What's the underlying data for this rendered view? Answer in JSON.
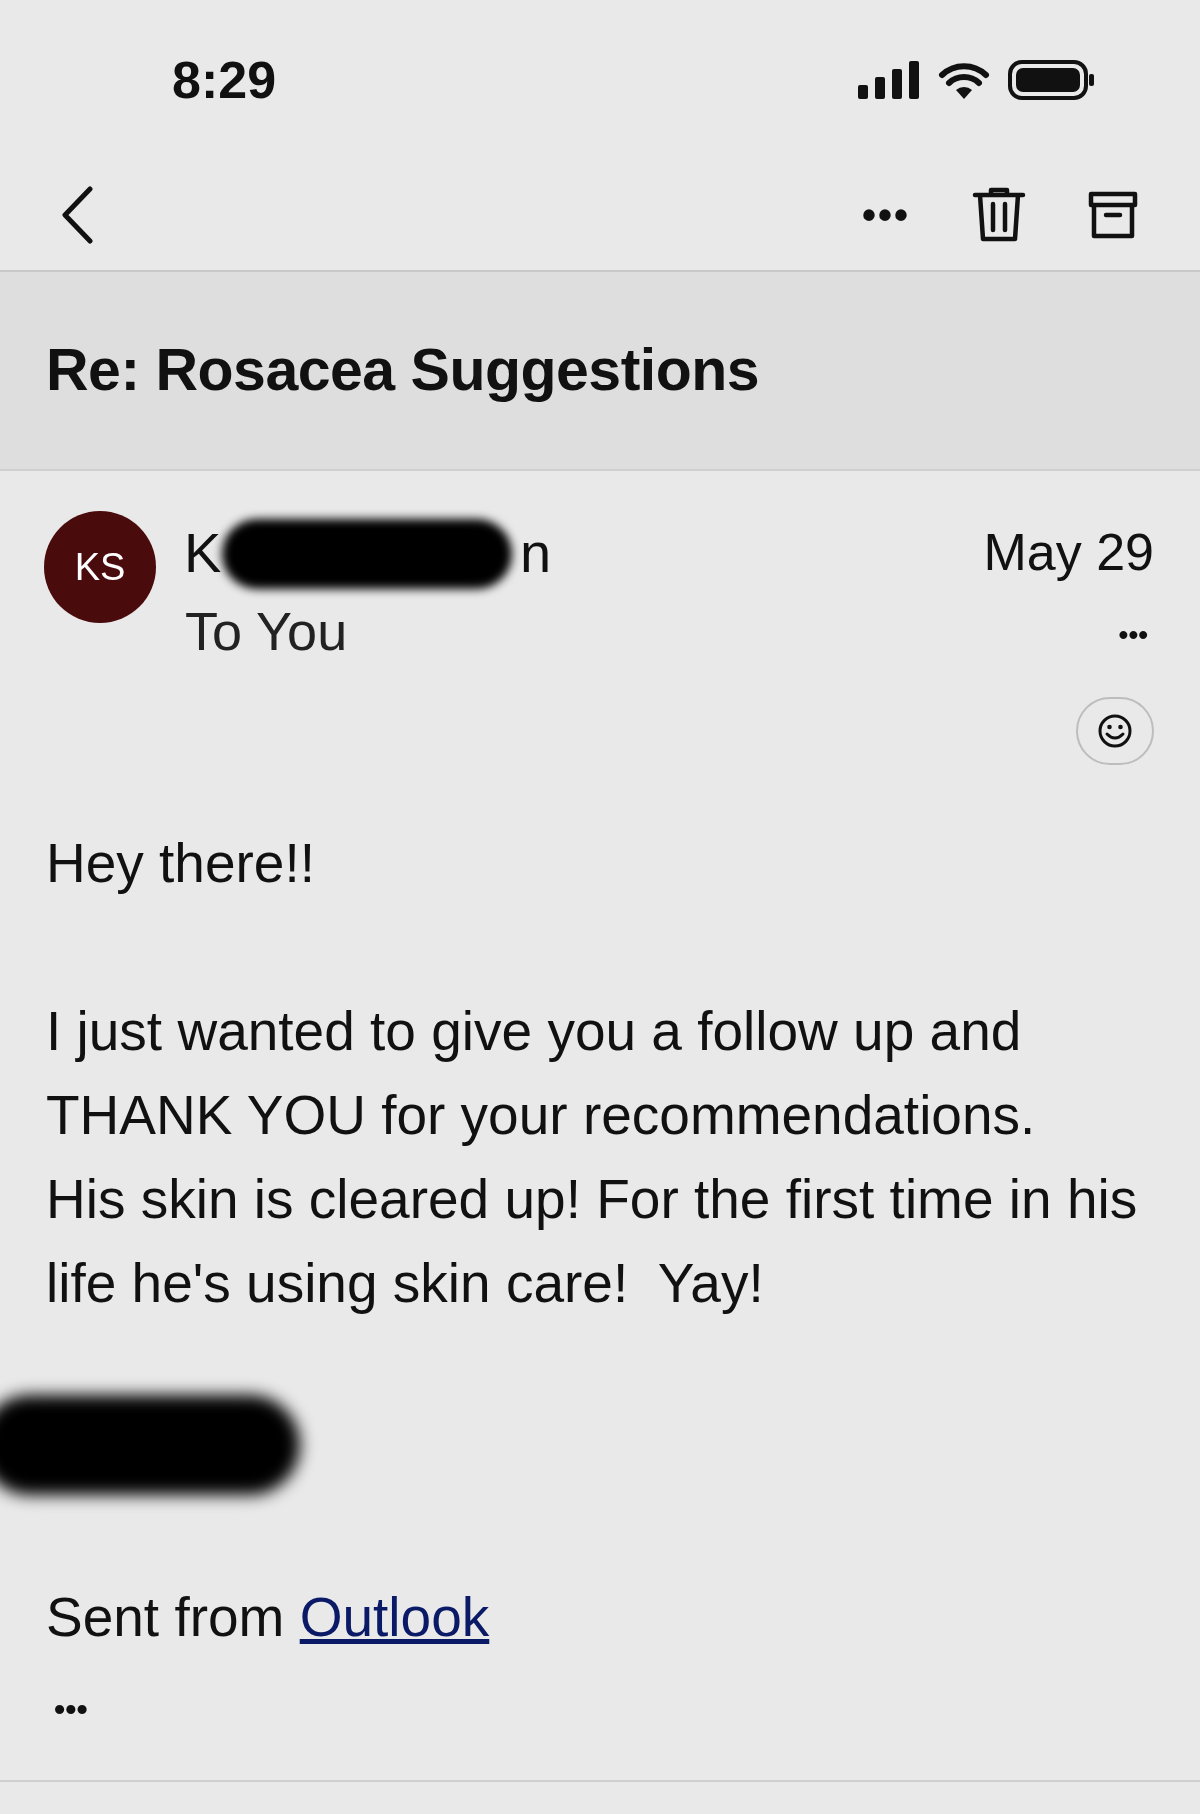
{
  "status_bar": {
    "time": "8:29"
  },
  "toolbar": {
    "more": "•••"
  },
  "subject": "Re: Rosacea Suggestions",
  "message": {
    "avatar_initials": "KS",
    "sender_start": "K",
    "sender_end": "n",
    "sender_redacted": true,
    "recipient": "To You",
    "date": "May 29",
    "more": "•••",
    "greeting": "Hey there!!",
    "body_lines": [
      "I just wanted to give you a follow up and",
      "THANK YOU for your recommendations.",
      "His skin is cleared up! For the first time in his",
      "life he's using skin care!  Yay!"
    ],
    "signature_redacted": true,
    "footer_text": "Sent from ",
    "footer_link": "Outlook",
    "trimmed": "•••"
  }
}
